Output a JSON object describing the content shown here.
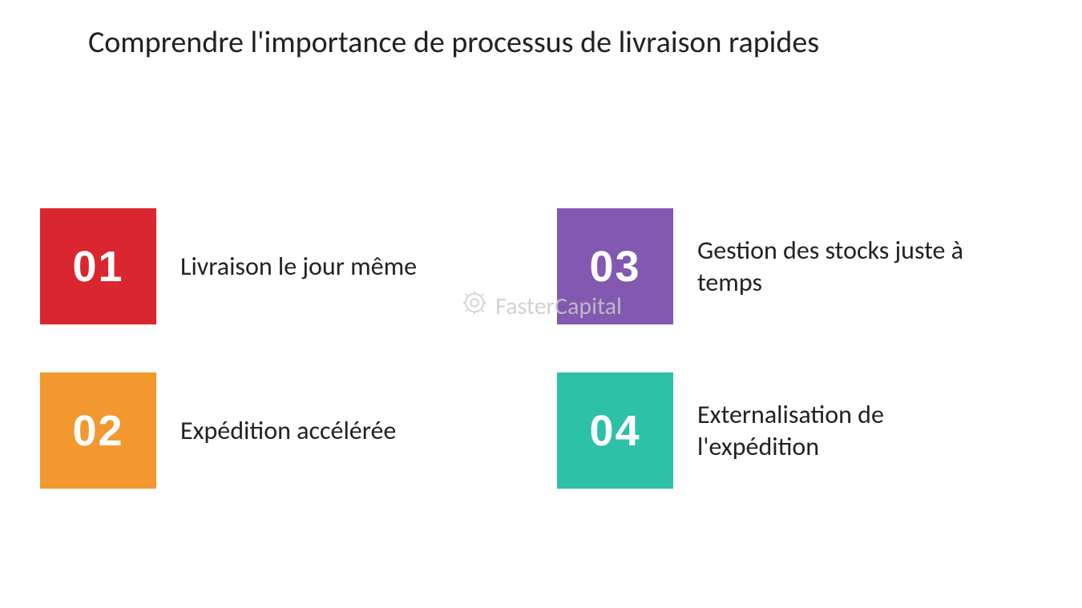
{
  "title": "Comprendre l'importance de processus de livraison rapides",
  "items": [
    {
      "num": "01",
      "label": "Livraison le jour même",
      "color": "#d9262f"
    },
    {
      "num": "03",
      "label": "Gestion des stocks juste à temps",
      "color": "#8258b0"
    },
    {
      "num": "02",
      "label": "Expédition accélérée",
      "color": "#f2982f"
    },
    {
      "num": "04",
      "label": "Externalisation de l'expédition",
      "color": "#2cc1a8"
    }
  ],
  "watermark": "FasterCapital"
}
